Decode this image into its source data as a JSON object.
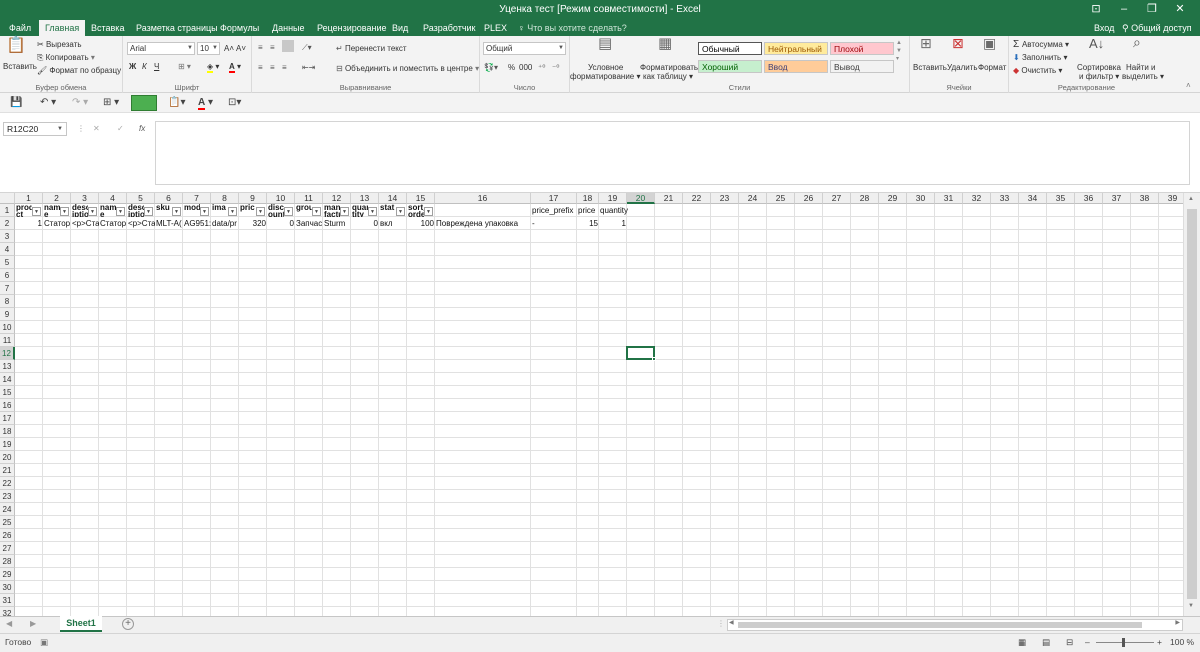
{
  "window": {
    "title": "Уценка тест [Режим совместимости] - Excel",
    "controls": [
      "⊡",
      "–",
      "❐",
      "✕"
    ]
  },
  "tabs": [
    "Файл",
    "Главная",
    "Вставка",
    "Разметка страницы",
    "Формулы",
    "Данные",
    "Рецензирование",
    "Вид",
    "Разработчик",
    "PLEX"
  ],
  "active_tab": "Главная",
  "tell_me": "Что вы хотите сделать?",
  "signin": "Вход",
  "share": "Общий доступ",
  "ribbon": {
    "clipboard": {
      "label": "Буфер обмена",
      "paste": "Вставить",
      "cut": "Вырезать",
      "copy": "Копировать",
      "format_painter": "Формат по образцу"
    },
    "font": {
      "label": "Шрифт",
      "name": "Arial",
      "size": "10",
      "bold": "Ж",
      "italic": "К",
      "underline": "Ч",
      "grow": "A˄",
      "shrink": "A˅"
    },
    "alignment": {
      "label": "Выравнивание",
      "wrap": "Перенести текст",
      "merge": "Объединить и поместить в центре"
    },
    "number": {
      "label": "Число",
      "format": "Общий",
      "percent": "%",
      "thousands": "000"
    },
    "styles": {
      "label": "Стили",
      "conditional": [
        "Условное",
        "форматирование"
      ],
      "as_table": [
        "Форматировать",
        "как таблицу"
      ],
      "cells": [
        {
          "text": "Обычный",
          "bg": "#ffffff",
          "color": "#000000"
        },
        {
          "text": "Нейтральный",
          "bg": "#ffeb9c",
          "color": "#9c5700"
        },
        {
          "text": "Плохой",
          "bg": "#ffc7ce",
          "color": "#9c0006"
        },
        {
          "text": "Хороший",
          "bg": "#c6efce",
          "color": "#006100"
        },
        {
          "text": "Ввод",
          "bg": "#ffcc99",
          "color": "#3f3f76"
        },
        {
          "text": "Вывод",
          "bg": "#f2f2f2",
          "color": "#3f3f3f"
        }
      ]
    },
    "cells": {
      "label": "Ячейки",
      "insert": "Вставить",
      "delete": "Удалить",
      "format": "Формат"
    },
    "editing": {
      "label": "Редактирование",
      "autosum": "Автосумма",
      "fill": "Заполнить",
      "clear": "Очистить",
      "sort": [
        "Сортировка",
        "и фильтр"
      ],
      "find": [
        "Найти и",
        "выделить"
      ]
    }
  },
  "formula_bar": {
    "name_box": "R12C20",
    "fx": "fx",
    "value": ""
  },
  "grid": {
    "columns": [
      "1",
      "2",
      "3",
      "4",
      "5",
      "6",
      "7",
      "8",
      "9",
      "10",
      "11",
      "12",
      "13",
      "14",
      "15",
      "16",
      "17",
      "18",
      "19",
      "20",
      "21",
      "22",
      "23",
      "24",
      "25",
      "26",
      "27",
      "28",
      "29",
      "30",
      "31",
      "32",
      "33",
      "34",
      "35",
      "36",
      "37",
      "38",
      "39"
    ],
    "rows": [
      "1",
      "2",
      "3",
      "4",
      "5",
      "6",
      "7",
      "8",
      "9",
      "10",
      "11",
      "12",
      "13",
      "14",
      "15",
      "16",
      "17",
      "18",
      "19",
      "20",
      "21",
      "22",
      "23",
      "24",
      "25",
      "26",
      "27",
      "28",
      "29",
      "30",
      "31",
      "32"
    ],
    "selected_col": "20",
    "selected_row": "12",
    "headers": [
      {
        "col": 0,
        "text": "produ ct_"
      },
      {
        "col": 1,
        "text": "nam e"
      },
      {
        "col": 2,
        "text": "descr iption"
      },
      {
        "col": 3,
        "text": "nam e"
      },
      {
        "col": 4,
        "text": "descr iption"
      },
      {
        "col": 5,
        "text": "sku"
      },
      {
        "col": 6,
        "text": "mod"
      },
      {
        "col": 7,
        "text": "ima"
      },
      {
        "col": 8,
        "text": "pric"
      },
      {
        "col": 9,
        "text": "disc ount"
      },
      {
        "col": 10,
        "text": "grou"
      },
      {
        "col": 11,
        "text": "manu factur"
      },
      {
        "col": 12,
        "text": "quan tity"
      },
      {
        "col": 13,
        "text": "stat"
      },
      {
        "col": 14,
        "text": "sort_ order"
      }
    ],
    "plain_headers": [
      {
        "col": 16,
        "text": "price_prefix"
      },
      {
        "col": 17,
        "text": "price"
      },
      {
        "col": 18,
        "text": "quantity"
      }
    ],
    "row2": [
      {
        "col": 0,
        "text": "1",
        "num": true
      },
      {
        "col": 1,
        "text": "Статор"
      },
      {
        "col": 2,
        "text": "<p>Ста"
      },
      {
        "col": 3,
        "text": "Статор"
      },
      {
        "col": 4,
        "text": "<p>Ста"
      },
      {
        "col": 5,
        "text": "MLT-A("
      },
      {
        "col": 6,
        "text": "AG951:"
      },
      {
        "col": 7,
        "text": "data/pr"
      },
      {
        "col": 8,
        "text": "320",
        "num": true
      },
      {
        "col": 9,
        "text": "0",
        "num": true
      },
      {
        "col": 10,
        "text": "Запчас"
      },
      {
        "col": 11,
        "text": "Sturm"
      },
      {
        "col": 12,
        "text": "0",
        "num": true
      },
      {
        "col": 13,
        "text": "вкл"
      },
      {
        "col": 14,
        "text": "100",
        "num": true
      },
      {
        "col": 15,
        "text": "Повреждена упаковка"
      },
      {
        "col": 16,
        "text": "-"
      },
      {
        "col": 17,
        "text": "15",
        "num": true
      },
      {
        "col": 18,
        "text": "1",
        "num": true
      }
    ]
  },
  "sheet": {
    "tab": "Sheet1",
    "add": "+"
  },
  "status": {
    "ready": "Готово",
    "zoom": "100 %",
    "zoom_minus": "–",
    "zoom_plus": "+"
  }
}
